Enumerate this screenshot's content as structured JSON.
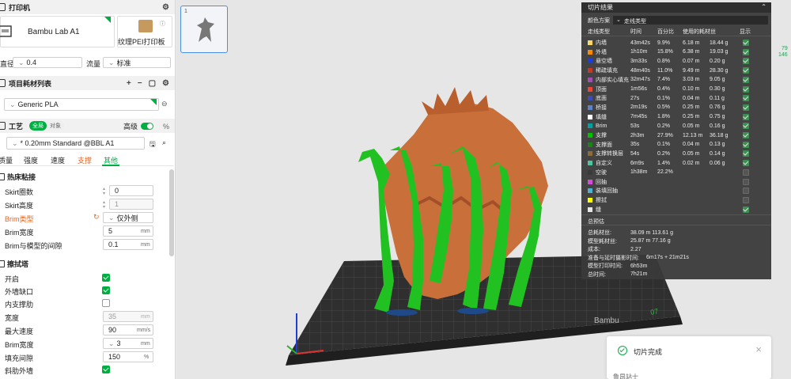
{
  "printer": {
    "section_title": "打印机",
    "name": "Bambu Lab A1",
    "plate": "纹理PEI打印板",
    "nozzle_label": "直径",
    "nozzle_value": "0.4",
    "flow_label": "流量",
    "flow_value": "标准"
  },
  "filament": {
    "section_title": "项目耗材列表",
    "add": "+",
    "remove": "−",
    "item": "Generic PLA"
  },
  "process": {
    "section_title": "工艺",
    "toggle_global": "全局",
    "toggle_object": "对象",
    "advanced_label": "高级",
    "profile": "* 0.20mm Standard @BBL A1",
    "tabs": [
      "质量",
      "强度",
      "速度",
      "支撑",
      "其他"
    ]
  },
  "adhesion": {
    "title": "热床粘接",
    "skirt_loops_label": "Skirt圈数",
    "skirt_loops_value": "0",
    "skirt_height_label": "Skirt高度",
    "skirt_height_value": "1",
    "brim_type_label": "Brim类型",
    "brim_type_value": "仅外侧",
    "brim_width_label": "Brim宽度",
    "brim_width_value": "5",
    "brim_width_unit": "mm",
    "brim_gap_label": "Brim与模型的间隙",
    "brim_gap_value": "0.1",
    "brim_gap_unit": "mm"
  },
  "prime_tower": {
    "title": "擦拭塔",
    "enable_label": "开启",
    "outer_gap_label": "外墙缺口",
    "inner_rib_label": "内支撑肋",
    "width_label": "宽度",
    "width_value": "35",
    "width_unit": "mm",
    "max_speed_label": "最大速度",
    "max_speed_value": "90",
    "max_speed_unit": "mm/s",
    "brim_width_label": "Brim宽度",
    "brim_width_value": "3",
    "brim_width_unit": "mm",
    "infill_gap_label": "填充间隙",
    "infill_gap_value": "150",
    "infill_gap_unit": "%",
    "rib_wall_label": "斜肋外墙"
  },
  "plate_thumb": {
    "index": "1"
  },
  "results": {
    "title": "切片结果",
    "color_scheme_label": "颜色方案",
    "color_scheme_value": "走线类型",
    "headers": [
      "走线类型",
      "时间",
      "百分比",
      "使用的耗材丝",
      "显示"
    ],
    "rows": [
      {
        "name": "内墙",
        "time": "43m42s",
        "pct": "9.9%",
        "len": "6.18 m",
        "wt": "18.44 g",
        "color": "#ffd966",
        "show": true
      },
      {
        "name": "外墙",
        "time": "1h10m",
        "pct": "15.8%",
        "len": "6.38 m",
        "wt": "19.03 g",
        "color": "#ff8a00",
        "show": true
      },
      {
        "name": "悬空墙",
        "time": "3m33s",
        "pct": "0.8%",
        "len": "0.07 m",
        "wt": "0.20 g",
        "color": "#1e3fd6",
        "show": true
      },
      {
        "name": "稀疏填充",
        "time": "48m40s",
        "pct": "11.0%",
        "len": "9.49 m",
        "wt": "28.30 g",
        "color": "#c0392b",
        "show": true
      },
      {
        "name": "内部实心填充",
        "time": "32m47s",
        "pct": "7.4%",
        "len": "3.03 m",
        "wt": "9.05 g",
        "color": "#a14db3",
        "show": true
      },
      {
        "name": "顶面",
        "time": "1m56s",
        "pct": "0.4%",
        "len": "0.10 m",
        "wt": "0.30 g",
        "color": "#e8463b",
        "show": true
      },
      {
        "name": "底面",
        "time": "27s",
        "pct": "0.1%",
        "len": "0.04 m",
        "wt": "0.11 g",
        "color": "#3d4db5",
        "show": true
      },
      {
        "name": "桥接",
        "time": "2m19s",
        "pct": "0.5%",
        "len": "0.25 m",
        "wt": "0.76 g",
        "color": "#5c84c4",
        "show": true
      },
      {
        "name": "填缝",
        "time": "7m45s",
        "pct": "1.8%",
        "len": "0.25 m",
        "wt": "0.75 g",
        "color": "#ffffff",
        "show": true
      },
      {
        "name": "Brim",
        "time": "53s",
        "pct": "0.2%",
        "len": "0.05 m",
        "wt": "0.16 g",
        "color": "#00a2a2",
        "show": true
      },
      {
        "name": "支撑",
        "time": "2h3m",
        "pct": "27.9%",
        "len": "12.13 m",
        "wt": "36.18 g",
        "color": "#00c000",
        "show": true
      },
      {
        "name": "支撑面",
        "time": "35s",
        "pct": "0.1%",
        "len": "0.04 m",
        "wt": "0.13 g",
        "color": "#1f7f1f",
        "show": true
      },
      {
        "name": "支撑转换层",
        "time": "54s",
        "pct": "0.2%",
        "len": "0.05 m",
        "wt": "0.14 g",
        "color": "#8a6d3b",
        "show": true
      },
      {
        "name": "自定义",
        "time": "6m9s",
        "pct": "1.4%",
        "len": "0.02 m",
        "wt": "0.06 g",
        "color": "#4fc4a0",
        "show": true
      },
      {
        "name": "空驶",
        "time": "1h38m",
        "pct": "22.2%",
        "len": "",
        "wt": "",
        "color": "#3a3a3a",
        "show": false
      },
      {
        "name": "回抽",
        "time": "",
        "pct": "",
        "len": "",
        "wt": "",
        "color": "#d04fd0",
        "show": false
      },
      {
        "name": "装填回抽",
        "time": "",
        "pct": "",
        "len": "",
        "wt": "",
        "color": "#4fb0d0",
        "show": false
      },
      {
        "name": "擦拭",
        "time": "",
        "pct": "",
        "len": "",
        "wt": "",
        "color": "#ffff00",
        "show": false
      },
      {
        "name": "缝",
        "time": "",
        "pct": "",
        "len": "",
        "wt": "",
        "color": "#e6e6e6",
        "show": true
      }
    ],
    "summary_title": "总预估",
    "summary": [
      {
        "label": "总耗材丝:",
        "value": "38.09 m    113.61 g"
      },
      {
        "label": "模型耗材丝:",
        "value": "25.87 m    77.16 g"
      },
      {
        "label": "成本:",
        "value": "2.27"
      },
      {
        "label": "准备与延时摄影时间:",
        "value": "6m17s + 21m21s"
      },
      {
        "label": "模型打印时间:",
        "value": "6h53m"
      },
      {
        "label": "总时间:",
        "value": "7h21m"
      }
    ]
  },
  "right_edge": {
    "line1": "79",
    "line2": "146"
  },
  "toast": {
    "text": "切片完成",
    "sub": "鲁昂站士"
  },
  "colors": {
    "accent": "#00ae42",
    "model": "#c9703a",
    "support": "#22c122",
    "panel": "#3a3a3a"
  }
}
